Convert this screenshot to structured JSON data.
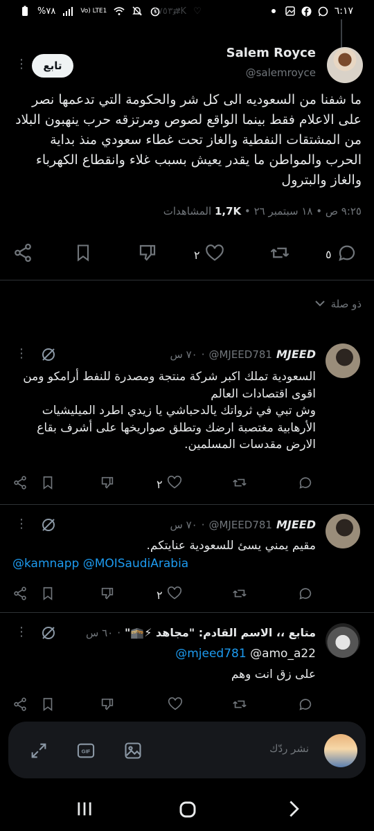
{
  "status_bar": {
    "time": "٦:١٧",
    "battery": "%٧٨",
    "network": "Vo) LTE1",
    "ghost_retweets": "٥٧٥",
    "ghost_likes": "٣٫٢K"
  },
  "tweet": {
    "author_name": "Salem Royce",
    "author_handle": "@salemroyce",
    "follow_label": "تابع",
    "text": "ما شفنا من السعوديه الى كل شر والحكومة التي تدعمها نصر على الاعلام فقط بينما الواقع لصوص ومرتزقه حرب ينهبون البلاد من المشتقات النفطية والغاز تحت غطاء سعودي منذ بداية الحرب والمواطن ما يقدر يعيش بسبب غلاء وانقطاع الكهرباء والغاز والبترول",
    "time": "٩:٢٥ ص",
    "date": "١٨ سبتمبر ٢٦",
    "views_count": "1,7K",
    "views_label": "المشاهدات",
    "replies": "٥",
    "likes": "٢"
  },
  "section": {
    "title": "ذو صلة"
  },
  "replies": [
    {
      "name": "MJEED",
      "handle": "@MJEED781",
      "time": "٧٠ س",
      "text": "السعودية تملك اكبر شركة منتجة ومصدرة للنفط أرامكو ومن اقوى اقتصادات العالم\nوش تبي في ثرواتك يالدحباشي يا زيدي اطرد الميليشيات الأرهابية مغتصبة ارضك وتطلق صواريخها على أشرف بقاع الارض مقدسات المسلمين.",
      "likes": "٢"
    },
    {
      "name": "MJEED",
      "handle": "@MJEED781",
      "time": "٧٠ س",
      "text": "مقيم يمني يسئ للسعودية عنايتكم.",
      "mentions": "@kamnapp @MOISaudiArabia",
      "likes": "٢"
    },
    {
      "name": "متابع ،، الاسم القادم: \"مجاهد ⚡🕋\"",
      "handle": "",
      "time": "٦٠ س",
      "reply_to_a": "@mjeed781",
      "reply_to_b": "@amo_a22",
      "text": "على زق انت وهم"
    }
  ],
  "composer": {
    "placeholder": "نشر ردّك"
  }
}
